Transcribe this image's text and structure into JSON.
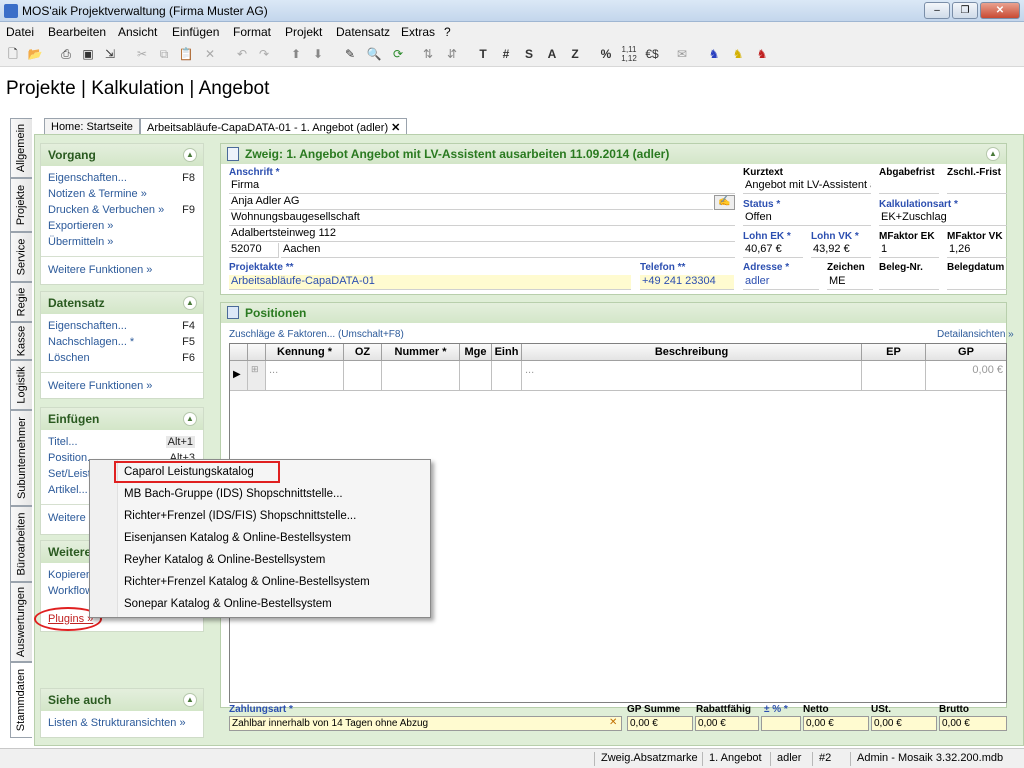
{
  "window": {
    "title": "MOS'aik Projektverwaltung (Firma Muster AG)"
  },
  "menu": [
    "Datei",
    "Bearbeiten",
    "Ansicht",
    "Einfügen",
    "Format",
    "Projekt",
    "Datensatz",
    "Extras",
    "?"
  ],
  "toolbar_text": [
    "T",
    "#",
    "S",
    "A",
    "Z",
    "%"
  ],
  "heading": "Projekte | Kalkulation | Angebot",
  "vtabs": [
    "Allgemein",
    "Projekte",
    "Service",
    "Regie",
    "Kasse",
    "Logistik",
    "Subunternehmer",
    "Büroarbeiten",
    "Auswertungen",
    "Stammdaten"
  ],
  "tabs": [
    "Home: Startseite",
    "Arbeitsabläufe-CapaDATA-01 - 1. Angebot (adler)"
  ],
  "vorgang": {
    "title": "Vorgang",
    "items": [
      {
        "label": "Eigenschaften...",
        "key": "F8"
      },
      {
        "label": "Notizen & Termine »",
        "key": ""
      },
      {
        "label": "Drucken & Verbuchen »",
        "key": "F9"
      },
      {
        "label": "Exportieren »",
        "key": ""
      },
      {
        "label": "Übermitteln »",
        "key": ""
      }
    ],
    "more": "Weitere Funktionen »"
  },
  "datensatz": {
    "title": "Datensatz",
    "items": [
      {
        "label": "Eigenschaften...",
        "key": "F4"
      },
      {
        "label": "Nachschlagen... *",
        "key": "F5"
      },
      {
        "label": "Löschen",
        "key": "F6"
      }
    ],
    "more": "Weitere Funktionen »"
  },
  "einfuegen": {
    "title": "Einfügen",
    "items": [
      {
        "label": "Titel...",
        "key": "Alt+1"
      },
      {
        "label": "Position...",
        "key": "Alt+3"
      },
      {
        "label": "Set/Leist",
        "key": ""
      },
      {
        "label": "Artikel...",
        "key": ""
      }
    ],
    "more": "Weitere"
  },
  "weitere": {
    "title": "Weitere",
    "items": [
      "Kopieren",
      "Workflow",
      "Plugins »"
    ]
  },
  "siehe": {
    "title": "Siehe auch",
    "link": "Listen & Strukturansichten »"
  },
  "zweig": {
    "title": "Zweig: 1. Angebot Angebot mit LV-Assistent ausarbeiten 11.09.2014 (adler)"
  },
  "form": {
    "anschrift_label": "Anschrift *",
    "addr": [
      "Firma",
      "Anja Adler AG",
      "Wohnungsbaugesellschaft",
      "Adalbertsteinweg 112"
    ],
    "plz": "52070",
    "ort": "Aachen",
    "kurztext_label": "Kurztext",
    "kurztext": "Angebot mit LV-Assistent a",
    "abgabefrist_label": "Abgabefrist",
    "zschl_label": "Zschl.-Frist",
    "status_label": "Status *",
    "status": "Offen",
    "kalk_label": "Kalkulationsart *",
    "kalk": "EK+Zuschlag",
    "lohnek_label": "Lohn EK *",
    "lohnek": "40,67 €",
    "lohnvk_label": "Lohn VK *",
    "lohnvk": "43,92 €",
    "mfek_label": "MFaktor EK",
    "mfek": "1",
    "mfvk_label": "MFaktor VK",
    "mfvk": "1,26",
    "projektakte_label": "Projektakte **",
    "projektakte": "Arbeitsabläufe-CapaDATA-01",
    "telefon_label": "Telefon **",
    "telefon": "+49 241 23304",
    "adresse_label": "Adresse *",
    "adresse": "adler",
    "zeichen_label": "Zeichen",
    "zeichen": "ME",
    "beleg_label": "Beleg-Nr.",
    "belegdatum_label": "Belegdatum"
  },
  "positionen": {
    "title": "Positionen",
    "zuschlaege": "Zuschläge & Faktoren... (Umschalt+F8)",
    "detail": "Detailansichten »",
    "cols": [
      "Kennung *",
      "OZ",
      "Nummer *",
      "Mge",
      "Einh",
      "Beschreibung",
      "EP",
      "GP"
    ],
    "row": {
      "kennung": "...",
      "beschreibung": "...",
      "gp": "0,00 €"
    }
  },
  "popup": [
    "Caparol Leistungskatalog",
    "MB Bach-Gruppe (IDS) Shopschnittstelle...",
    "Richter+Frenzel (IDS/FIS) Shopschnittstelle...",
    "Eisenjansen Katalog & Online-Bestellsystem",
    "Reyher Katalog & Online-Bestellsystem",
    "Richter+Frenzel Katalog & Online-Bestellsystem",
    "Sonepar Katalog & Online-Bestellsystem"
  ],
  "footer": {
    "zahlungsart_label": "Zahlungsart *",
    "zahlungsart": "Zahlbar innerhalb von 14 Tagen ohne Abzug",
    "gpsumme_label": "GP Summe",
    "gpsumme": "0,00 €",
    "rabatt_label": "Rabattfähig",
    "rabatt": "0,00 €",
    "pct_label": "± % *",
    "netto_label": "Netto",
    "netto": "0,00 €",
    "ust_label": "USt.",
    "ust": "0,00 €",
    "brutto_label": "Brutto",
    "brutto": "0,00 €"
  },
  "status": [
    "Zweig.Absatzmarke",
    "1. Angebot",
    "adler",
    "#2",
    "Admin - Mosaik 3.32.200.mdb"
  ],
  "colors": {
    "accent_green": "#2a7a20",
    "link_blue": "#2c5a9a",
    "highlight_red": "#e02020"
  }
}
